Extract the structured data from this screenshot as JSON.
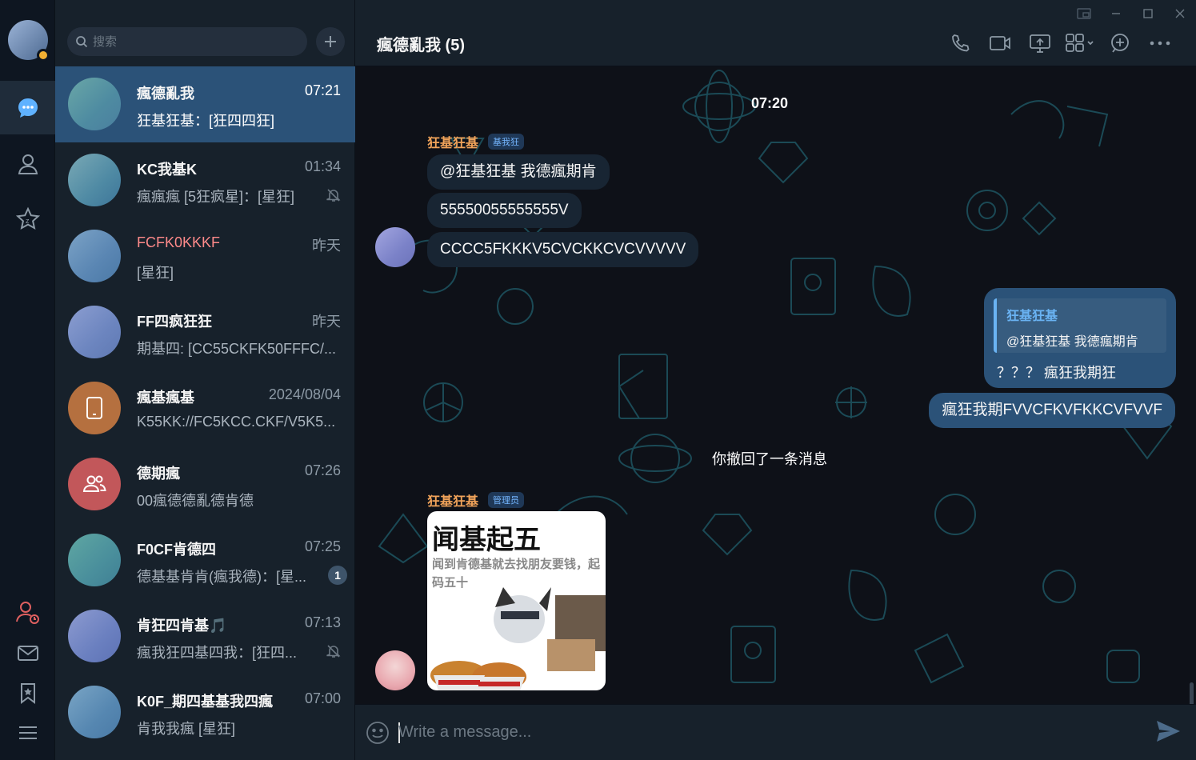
{
  "colors": {
    "accent": "#2b5278",
    "link": "#6ab3f3",
    "sender_name": "#f0a35a",
    "unread_name": "#ff8a8a"
  },
  "search": {
    "placeholder": "搜索"
  },
  "rail": {
    "items": [
      "chats-icon",
      "contacts-icon",
      "favorites-icon",
      "user-status-icon",
      "mail-icon",
      "bookmark-icon",
      "menu-icon"
    ]
  },
  "chats": [
    {
      "name": "瘋德亂我",
      "time": "07:21",
      "preview": "狂基狂基：[狂四四狂]",
      "active": true
    },
    {
      "name": "KC我基K",
      "time": "01:34",
      "preview": "瘋瘋瘋 [5狂疯星]：[星狂]",
      "muted": true
    },
    {
      "name": "FCFK0KKKF",
      "time": "昨天",
      "preview": "[星狂]"
    },
    {
      "name": "FF四疯狂狂",
      "time": "昨天",
      "preview": "期基四: [CC55CKFK50FFFC/..."
    },
    {
      "name": "瘋基瘋基",
      "time": "2024/08/04",
      "preview": "K55KK://FC5KCC.CKF/V5K5..."
    },
    {
      "name": "德期瘋",
      "time": "07:26",
      "preview": "00瘋德德亂德肯德"
    },
    {
      "name": "F0CF肯德四",
      "time": "07:25",
      "preview": "德基基肯肯(瘋我德)：[星...",
      "unread": "1"
    },
    {
      "name": "肯狂四肯基🎵",
      "time": "07:13",
      "preview": "瘋我狂四基四我：[狂四...",
      "muted": true
    },
    {
      "name": "K0F_期四基基我四瘋",
      "time": "07:00",
      "preview": "肯我我瘋 [星狂]"
    }
  ],
  "header": {
    "title": "瘋德亂我 (5)"
  },
  "messages": {
    "time_chip": "07:20",
    "group1": {
      "sender": "狂基狂基",
      "tag": "基我狂",
      "lines": [
        "@狂基狂基 我德瘋期肯",
        "55550055555555V",
        "CCCC5FKKKV5CVCKKCVCVVVVV"
      ]
    },
    "outgoing": {
      "quote_name": "狂基狂基",
      "quote_text": "@狂基狂基 我德瘋期肯",
      "reply_text": "？？？ 瘋狂我期狂",
      "second": "瘋狂我期FVVCFKVFKKCVFVVF"
    },
    "service": "你撤回了一条消息",
    "group2": {
      "sender": "狂基狂基",
      "tag": "管理员",
      "sticker_title": "闻基起五",
      "sticker_sub": "闻到肯德基就去找朋友要钱，起码五十"
    }
  },
  "composer": {
    "placeholder": "Write a message..."
  }
}
